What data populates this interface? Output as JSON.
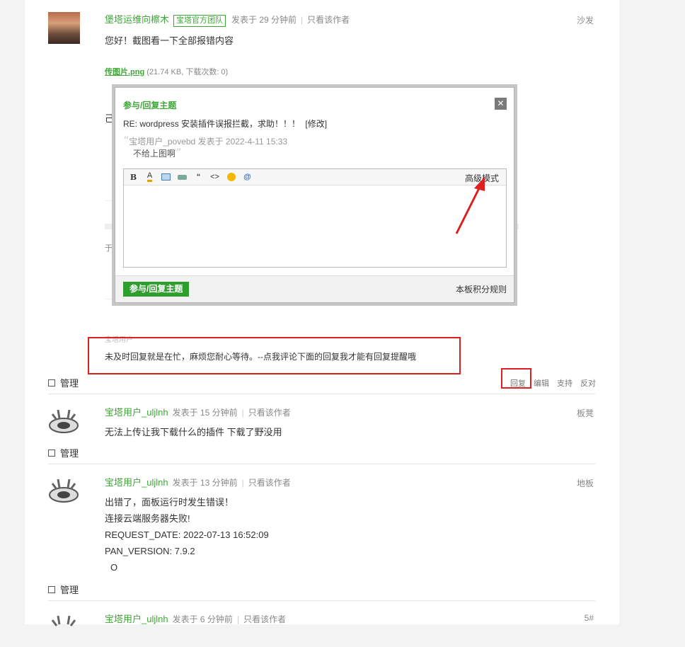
{
  "posts": [
    {
      "author": "堡塔运维向檫木",
      "badge": "宝塔官方团队",
      "posted": "发表于 29 分钟前",
      "only_author": "只看该作者",
      "floor": "沙发",
      "message": "您好！截图看一下全部报错内容",
      "attachment_name": "传图片.png",
      "attachment_meta": "(21.74 KB, 下载次数: 0)",
      "manage": "管理"
    },
    {
      "author": "宝塔用户_uljlnh",
      "posted": "发表于 15 分钟前",
      "only_author": "只看该作者",
      "floor": "板凳",
      "message": "无法上传让我下载什么的插件 下载了野没用",
      "manage": "管理"
    },
    {
      "author": "宝塔用户_uljlnh",
      "posted": "发表于 13 分钟前",
      "only_author": "只看该作者",
      "floor": "地板",
      "lines": [
        "出错了，面板运行时发生错误！",
        "连接云端服务器失败!",
        "REQUEST_DATE: 2022-07-13 16:52:09",
        "PAN_VERSION: 7.9.2",
        "O"
      ],
      "manage": "管理"
    },
    {
      "author": "宝塔用户_uljlnh",
      "posted": "发表于 6 分钟前",
      "only_author": "只看该作者",
      "floor": "5#"
    }
  ],
  "signature": "未及时回复就是在忙，麻烦您耐心等待。--点我评论下面的回复我才能有回复提醒哦",
  "post_actions": [
    "回复",
    "编辑",
    "支持",
    "反对"
  ],
  "modal": {
    "title": "参与/回复主题",
    "subject": "RE: wordpress 安装插件误报拦截，求助！！！",
    "edit_link": "[修改]",
    "quote_author": "宝塔用户_povebd 发表于 2022-4-11 15:33",
    "quote_text": "不给上图啊",
    "toolbar": [
      "B",
      "A",
      "img",
      "att",
      "“",
      "<>",
      "☺",
      "@"
    ],
    "advanced_mode": "高级模式",
    "submit": "参与/回复主题",
    "rules": "本板积分规则",
    "close": "✕"
  },
  "colors": {
    "accent": "#3ea737",
    "highlight": "#e02020"
  },
  "behind_fragments": {
    "left_text": "己装",
    "left_text2": "于 1",
    "sig_label": "宝塔用户"
  }
}
